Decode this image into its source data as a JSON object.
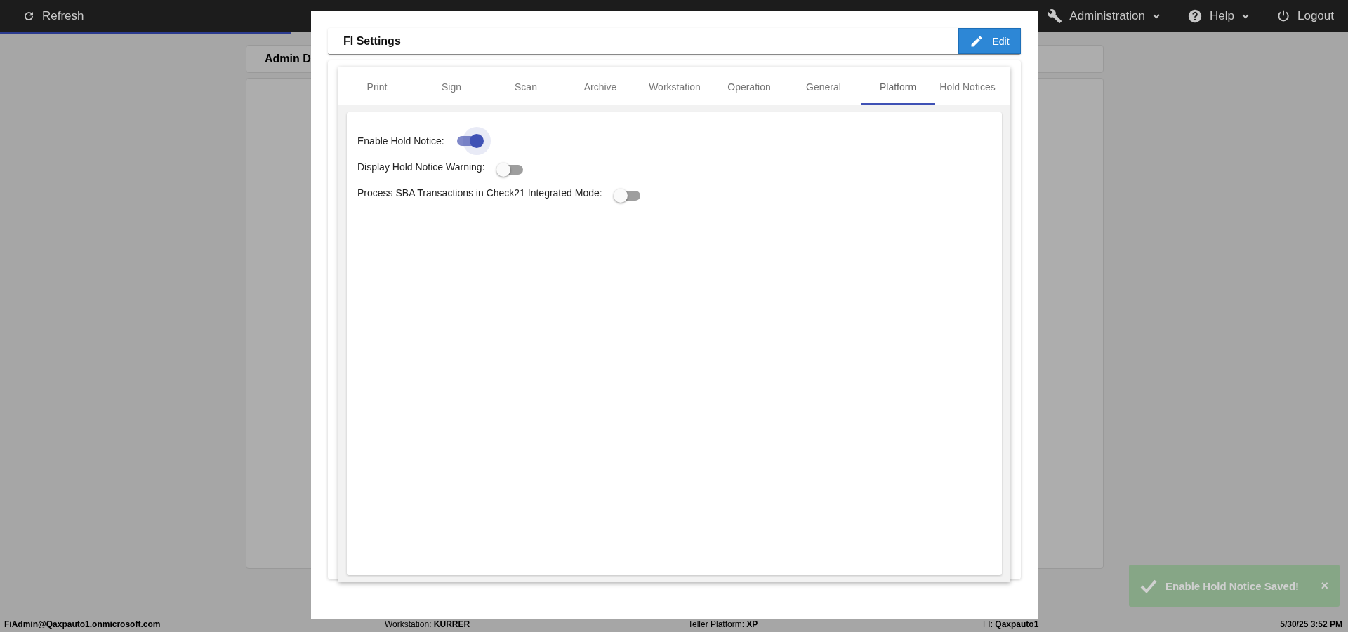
{
  "topbar": {
    "refresh": "Refresh",
    "menus": [
      {
        "label": "Administration",
        "kind": "wrench"
      },
      {
        "label": "Help",
        "kind": "help"
      }
    ],
    "logout": "Logout"
  },
  "page": {
    "card_title": "Admin D"
  },
  "modal": {
    "title": "FI Settings",
    "edit": "Edit",
    "tabs": [
      {
        "label": "Print",
        "selected": false
      },
      {
        "label": "Sign",
        "selected": false
      },
      {
        "label": "Scan",
        "selected": false
      },
      {
        "label": "Archive",
        "selected": false
      },
      {
        "label": "Workstation",
        "selected": false
      },
      {
        "label": "Operation",
        "selected": false
      },
      {
        "label": "General",
        "selected": false
      },
      {
        "label": "Platform",
        "selected": true
      },
      {
        "label": "Hold Notices",
        "selected": false
      }
    ],
    "settings": [
      {
        "label": "Enable Hold Notice:",
        "on": true
      },
      {
        "label": "Display Hold Notice Warning:",
        "on": false
      },
      {
        "label": "Process SBA Transactions in Check21 Integrated Mode:",
        "on": false
      }
    ]
  },
  "toast": {
    "message": "Enable Hold Notice Saved!",
    "close": "×"
  },
  "status_bar": [
    {
      "text": "FiAdmin@Qaxpauto1.onmicrosoft.com"
    },
    {
      "text": "Workstation: **KURRER**"
    },
    {
      "text": "Teller Platform: **XP**"
    },
    {
      "text": "FI: **Qaxpauto1**"
    },
    {
      "text": "5/30/25 3:52 PM"
    }
  ]
}
